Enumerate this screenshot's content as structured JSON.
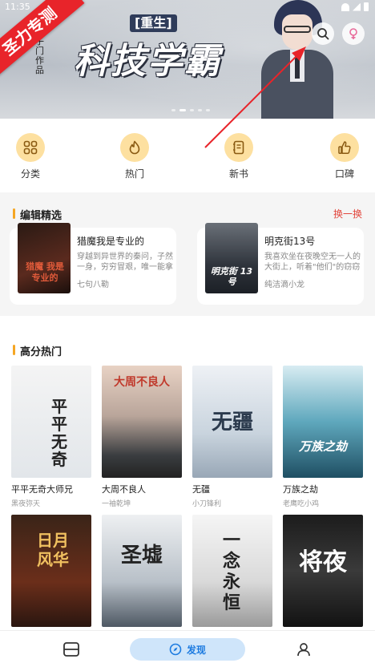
{
  "status_bar": {
    "time": "11:35"
  },
  "banner": {
    "ribbon_text": "圣力专测",
    "tag": "[重生]",
    "title": "科技学霸",
    "side_text": "子门 作品",
    "search_icon": "search-icon",
    "gender_icon": "female-icon",
    "carousel": {
      "count": 5,
      "active": 1
    }
  },
  "quick_nav": [
    {
      "label": "分类",
      "icon": "grid-icon"
    },
    {
      "label": "热门",
      "icon": "flame-icon"
    },
    {
      "label": "新书",
      "icon": "notebook-icon"
    },
    {
      "label": "口碑",
      "icon": "thumbs-up-icon"
    }
  ],
  "editor_picks": {
    "title": "编辑精选",
    "swap_label": "换一换",
    "items": [
      {
        "title": "猎魔我是专业的",
        "desc": "穿越到异世界的秦问，子然一身，穷穷冒艰，唯一能拿得出...",
        "author": "七句八勒",
        "cover_text": "猎魔 我是专业的"
      },
      {
        "title": "明克街13号",
        "desc": "我喜欢坐在夜晚空无一人的大街上，听着\"他们\"的窃窃私语...",
        "author": "纯洁滴小龙",
        "cover_text": "明克街 13号"
      }
    ]
  },
  "hot_books": {
    "title": "高分热门",
    "items": [
      {
        "name": "平平无奇大师兄",
        "author": "黑夜弥天",
        "cover_text": "平平无奇"
      },
      {
        "name": "大周不良人",
        "author": "一袖乾坤",
        "cover_text": "大周不良人"
      },
      {
        "name": "无疆",
        "author": "小刀锋利",
        "cover_text": "无疆"
      },
      {
        "name": "万族之劫",
        "author": "老鹰吃小鸡",
        "cover_text": "万族之劫"
      },
      {
        "name": "",
        "author": "",
        "cover_text": "日月风华"
      },
      {
        "name": "",
        "author": "",
        "cover_text": "圣墟"
      },
      {
        "name": "",
        "author": "",
        "cover_text": "一念永恒"
      },
      {
        "name": "",
        "author": "",
        "cover_text": "将夜"
      }
    ]
  },
  "bottom_nav": {
    "bookshelf_icon": "bookshelf-icon",
    "discover_label": "发现",
    "discover_icon": "compass-icon",
    "profile_icon": "user-icon"
  },
  "colors": {
    "accent": "#f5a623",
    "swap": "#e2463c",
    "nav_active": "#1d7be0",
    "ribbon": "#e8242a"
  }
}
